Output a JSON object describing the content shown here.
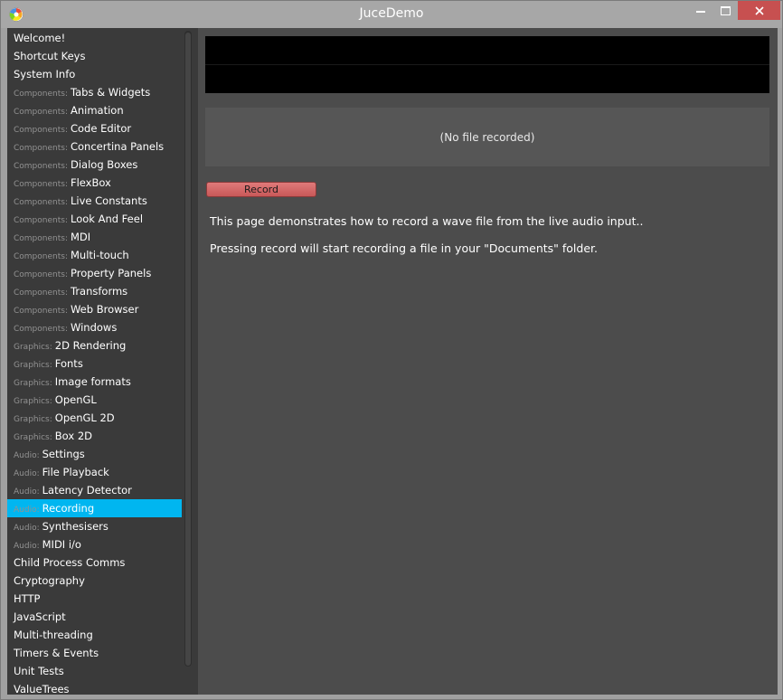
{
  "window": {
    "title": "JuceDemo",
    "icons": {
      "app": "juce-logo-icon",
      "minimize": "minimize-icon",
      "maximize": "maximize-icon",
      "close": "close-icon"
    },
    "colors": {
      "selected": "#00b6f0",
      "sidebar_bg": "#3a3a3a",
      "main_bg": "#4c4c4c",
      "close_btn": "#c75050",
      "record_btn": "#d86a6a"
    }
  },
  "sidebar": {
    "items": [
      {
        "category": "",
        "label": "Welcome!"
      },
      {
        "category": "",
        "label": "Shortcut Keys"
      },
      {
        "category": "",
        "label": "System Info"
      },
      {
        "category": "Components:",
        "label": "Tabs & Widgets"
      },
      {
        "category": "Components:",
        "label": "Animation"
      },
      {
        "category": "Components:",
        "label": "Code Editor"
      },
      {
        "category": "Components:",
        "label": "Concertina Panels"
      },
      {
        "category": "Components:",
        "label": "Dialog Boxes"
      },
      {
        "category": "Components:",
        "label": "FlexBox"
      },
      {
        "category": "Components:",
        "label": "Live Constants"
      },
      {
        "category": "Components:",
        "label": "Look And Feel"
      },
      {
        "category": "Components:",
        "label": "MDI"
      },
      {
        "category": "Components:",
        "label": "Multi-touch"
      },
      {
        "category": "Components:",
        "label": "Property Panels"
      },
      {
        "category": "Components:",
        "label": "Transforms"
      },
      {
        "category": "Components:",
        "label": "Web Browser"
      },
      {
        "category": "Components:",
        "label": "Windows"
      },
      {
        "category": "Graphics:",
        "label": "2D Rendering"
      },
      {
        "category": "Graphics:",
        "label": "Fonts"
      },
      {
        "category": "Graphics:",
        "label": "Image formats"
      },
      {
        "category": "Graphics:",
        "label": "OpenGL"
      },
      {
        "category": "Graphics:",
        "label": "OpenGL 2D"
      },
      {
        "category": "Graphics:",
        "label": "Box 2D"
      },
      {
        "category": "Audio:",
        "label": "Settings"
      },
      {
        "category": "Audio:",
        "label": "File Playback"
      },
      {
        "category": "Audio:",
        "label": "Latency Detector"
      },
      {
        "category": "Audio:",
        "label": "Recording",
        "selected": true
      },
      {
        "category": "Audio:",
        "label": "Synthesisers"
      },
      {
        "category": "Audio:",
        "label": "MIDI i/o"
      },
      {
        "category": "",
        "label": "Child Process Comms"
      },
      {
        "category": "",
        "label": "Cryptography"
      },
      {
        "category": "",
        "label": "HTTP"
      },
      {
        "category": "",
        "label": "JavaScript"
      },
      {
        "category": "",
        "label": "Multi-threading"
      },
      {
        "category": "",
        "label": "Timers & Events"
      },
      {
        "category": "",
        "label": "Unit Tests"
      },
      {
        "category": "",
        "label": "ValueTrees"
      }
    ]
  },
  "main": {
    "file_status": "(No file recorded)",
    "record_label": "Record",
    "description_1": "This page demonstrates how to record a wave file from the live audio input..",
    "description_2": "Pressing record will start recording a file in your \"Documents\" folder."
  }
}
